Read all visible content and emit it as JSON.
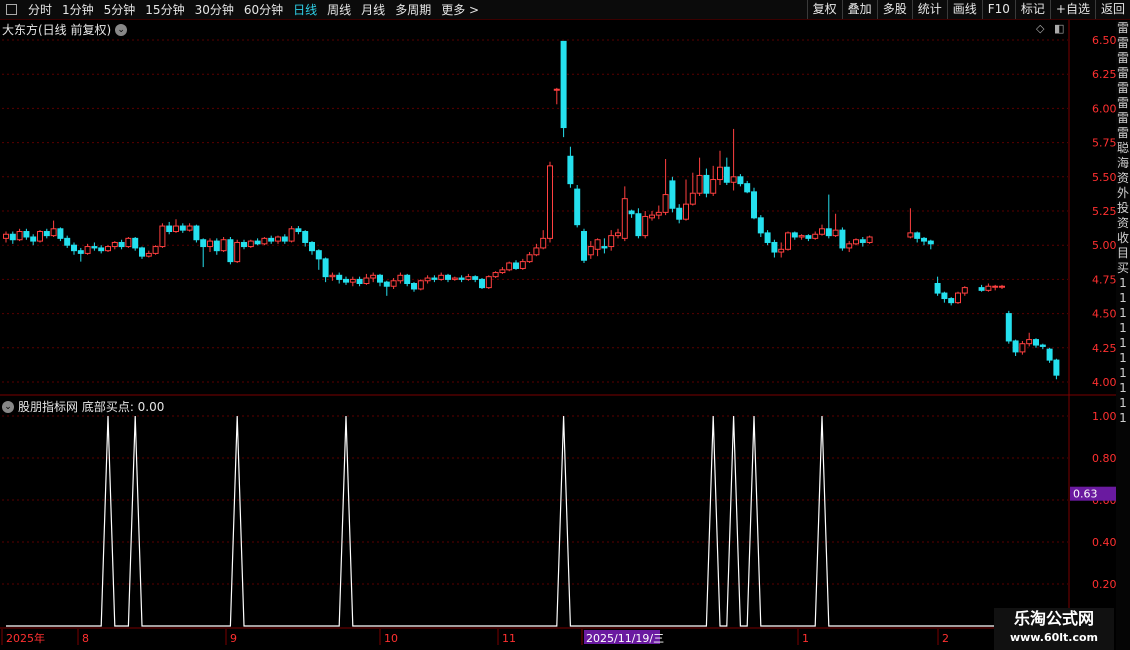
{
  "toolbar": {
    "periods": [
      "分时",
      "1分钟",
      "5分钟",
      "15分钟",
      "30分钟",
      "60分钟",
      "日线",
      "周线",
      "月线",
      "多周期",
      "更多 >"
    ],
    "active_index": 6,
    "right_buttons": [
      "复权",
      "叠加",
      "多股",
      "统计",
      "画线",
      "F10",
      "标记",
      "+自选",
      "返回"
    ]
  },
  "main_title": "大东方(日线 前复权)",
  "indicator_title": "股朋指标网  底部买点: 0.00",
  "sidebar_chars": [
    "雷",
    "雷",
    "雷",
    "雷",
    "雷",
    "雷",
    "雷",
    "雷",
    "聪",
    "海",
    "资",
    "外",
    "投",
    "资",
    "收",
    "目",
    "买",
    "1",
    "1",
    "1",
    "1",
    "1",
    "1",
    "1",
    "1",
    "1",
    "1"
  ],
  "watermark": {
    "line1": "乐淘公式网",
    "line2": "www.60lt.com"
  },
  "colors": {
    "up": "#ff4040",
    "down": "#25e0ee",
    "grid": "#5a0000",
    "axis": "#ff3030",
    "line": "#ffffff",
    "highlight": "#6a1aa0"
  },
  "chart_data": [
    {
      "type": "candlestick",
      "title": "大东方(日线 前复权)",
      "ylim": [
        3.94,
        6.55
      ],
      "y_ticks": [
        "6.50",
        "6.25",
        "6.00",
        "5.75",
        "5.50",
        "5.25",
        "5.00",
        "4.75",
        "4.50",
        "4.25",
        "4.00"
      ],
      "candles": [
        [
          5.05,
          5.08,
          5.1,
          5.02
        ],
        [
          5.08,
          5.04,
          5.1,
          5.01
        ],
        [
          5.04,
          5.1,
          5.12,
          5.03
        ],
        [
          5.1,
          5.06,
          5.12,
          5.04
        ],
        [
          5.06,
          5.03,
          5.08,
          5.0
        ],
        [
          5.03,
          5.1,
          5.11,
          5.02
        ],
        [
          5.1,
          5.07,
          5.12,
          5.05
        ],
        [
          5.07,
          5.12,
          5.18,
          5.06
        ],
        [
          5.12,
          5.05,
          5.13,
          5.03
        ],
        [
          5.05,
          5.0,
          5.07,
          4.98
        ],
        [
          5.0,
          4.96,
          5.02,
          4.93
        ],
        [
          4.96,
          4.94,
          4.98,
          4.88
        ],
        [
          4.94,
          4.99,
          5.01,
          4.93
        ],
        [
          4.99,
          4.98,
          5.02,
          4.96
        ],
        [
          4.98,
          4.96,
          5.0,
          4.94
        ],
        [
          4.96,
          4.99,
          5.0,
          4.95
        ],
        [
          4.99,
          5.02,
          5.03,
          4.97
        ],
        [
          5.02,
          4.99,
          5.04,
          4.97
        ],
        [
          4.99,
          5.05,
          5.06,
          4.98
        ],
        [
          5.05,
          4.98,
          5.06,
          4.96
        ],
        [
          4.98,
          4.92,
          4.99,
          4.9
        ],
        [
          4.92,
          4.94,
          4.96,
          4.91
        ],
        [
          4.94,
          4.99,
          5.0,
          4.93
        ],
        [
          4.99,
          5.14,
          5.16,
          4.98
        ],
        [
          5.14,
          5.1,
          5.17,
          5.08
        ],
        [
          5.1,
          5.14,
          5.19,
          5.09
        ],
        [
          5.14,
          5.11,
          5.16,
          5.09
        ],
        [
          5.11,
          5.14,
          5.16,
          5.1
        ],
        [
          5.14,
          5.04,
          5.15,
          5.02
        ],
        [
          5.04,
          4.99,
          5.05,
          4.84
        ],
        [
          4.99,
          5.03,
          5.05,
          4.95
        ],
        [
          5.03,
          4.96,
          5.05,
          4.93
        ],
        [
          4.96,
          5.04,
          5.06,
          4.95
        ],
        [
          5.04,
          4.88,
          5.06,
          4.86
        ],
        [
          4.88,
          5.02,
          5.04,
          4.87
        ],
        [
          5.02,
          4.99,
          5.04,
          4.97
        ],
        [
          4.99,
          5.03,
          5.04,
          4.98
        ],
        [
          5.03,
          5.01,
          5.05,
          5.0
        ],
        [
          5.01,
          5.05,
          5.06,
          5.0
        ],
        [
          5.05,
          5.03,
          5.07,
          5.01
        ],
        [
          5.03,
          5.06,
          5.07,
          5.01
        ],
        [
          5.06,
          5.03,
          5.08,
          5.01
        ],
        [
          5.03,
          5.12,
          5.14,
          5.02
        ],
        [
          5.12,
          5.1,
          5.14,
          5.08
        ],
        [
          5.1,
          5.02,
          5.11,
          4.99
        ],
        [
          5.02,
          4.96,
          5.03,
          4.93
        ],
        [
          4.96,
          4.9,
          4.97,
          4.82
        ],
        [
          4.9,
          4.77,
          4.91,
          4.73
        ],
        [
          4.77,
          4.78,
          4.8,
          4.74
        ],
        [
          4.78,
          4.75,
          4.8,
          4.72
        ],
        [
          4.75,
          4.73,
          4.77,
          4.71
        ],
        [
          4.73,
          4.75,
          4.77,
          4.7
        ],
        [
          4.75,
          4.72,
          4.77,
          4.7
        ],
        [
          4.72,
          4.76,
          4.79,
          4.71
        ],
        [
          4.76,
          4.78,
          4.8,
          4.73
        ],
        [
          4.78,
          4.73,
          4.79,
          4.7
        ],
        [
          4.73,
          4.7,
          4.74,
          4.63
        ],
        [
          4.7,
          4.74,
          4.76,
          4.68
        ],
        [
          4.74,
          4.78,
          4.8,
          4.72
        ],
        [
          4.78,
          4.72,
          4.79,
          4.7
        ],
        [
          4.72,
          4.68,
          4.73,
          4.66
        ],
        [
          4.68,
          4.74,
          4.75,
          4.67
        ],
        [
          4.74,
          4.76,
          4.78,
          4.72
        ],
        [
          4.76,
          4.75,
          4.78,
          4.73
        ],
        [
          4.75,
          4.78,
          4.8,
          4.74
        ],
        [
          4.78,
          4.75,
          4.79,
          4.73
        ],
        [
          4.75,
          4.76,
          4.77,
          4.74
        ],
        [
          4.76,
          4.75,
          4.78,
          4.73
        ],
        [
          4.75,
          4.77,
          4.79,
          4.74
        ],
        [
          4.77,
          4.75,
          4.78,
          4.73
        ],
        [
          4.75,
          4.69,
          4.76,
          4.68
        ],
        [
          4.69,
          4.77,
          4.78,
          4.68
        ],
        [
          4.77,
          4.8,
          4.81,
          4.76
        ],
        [
          4.8,
          4.82,
          4.84,
          4.79
        ],
        [
          4.82,
          4.87,
          4.88,
          4.81
        ],
        [
          4.87,
          4.83,
          4.89,
          4.82
        ],
        [
          4.83,
          4.88,
          4.9,
          4.82
        ],
        [
          4.88,
          4.93,
          4.95,
          4.87
        ],
        [
          4.93,
          4.98,
          5.01,
          4.92
        ],
        [
          4.98,
          5.05,
          5.11,
          4.97
        ],
        [
          5.05,
          5.58,
          5.61,
          5.02
        ],
        [
          6.14,
          6.14,
          6.15,
          6.03
        ],
        [
          6.49,
          5.86,
          6.49,
          5.79
        ],
        [
          5.65,
          5.45,
          5.72,
          5.42
        ],
        [
          5.41,
          5.15,
          5.44,
          5.13
        ],
        [
          5.1,
          4.89,
          5.12,
          4.87
        ],
        [
          4.93,
          4.99,
          5.03,
          4.9
        ],
        [
          4.97,
          5.04,
          5.05,
          4.92
        ],
        [
          4.99,
          4.98,
          5.05,
          4.94
        ],
        [
          4.99,
          5.07,
          5.11,
          4.96
        ],
        [
          5.07,
          5.09,
          5.12,
          5.05
        ],
        [
          5.05,
          5.34,
          5.43,
          5.03
        ],
        [
          5.25,
          5.23,
          5.26,
          5.2
        ],
        [
          5.23,
          5.07,
          5.27,
          5.05
        ],
        [
          5.07,
          5.21,
          5.25,
          5.05
        ],
        [
          5.2,
          5.22,
          5.25,
          5.18
        ],
        [
          5.22,
          5.24,
          5.29,
          5.19
        ],
        [
          5.24,
          5.37,
          5.63,
          5.22
        ],
        [
          5.47,
          5.27,
          5.5,
          5.24
        ],
        [
          5.27,
          5.19,
          5.3,
          5.16
        ],
        [
          5.19,
          5.3,
          5.48,
          5.18
        ],
        [
          5.3,
          5.38,
          5.53,
          5.29
        ],
        [
          5.38,
          5.51,
          5.64,
          5.36
        ],
        [
          5.51,
          5.38,
          5.56,
          5.35
        ],
        [
          5.38,
          5.48,
          5.58,
          5.36
        ],
        [
          5.48,
          5.57,
          5.69,
          5.44
        ],
        [
          5.57,
          5.46,
          5.64,
          5.44
        ],
        [
          5.46,
          5.5,
          5.85,
          5.4
        ],
        [
          5.5,
          5.45,
          5.52,
          5.43
        ],
        [
          5.45,
          5.39,
          5.47,
          5.38
        ],
        [
          5.39,
          5.2,
          5.42,
          5.19
        ],
        [
          5.2,
          5.09,
          5.22,
          5.06
        ],
        [
          5.09,
          5.02,
          5.11,
          5.0
        ],
        [
          5.02,
          4.95,
          5.04,
          4.91
        ],
        [
          4.95,
          4.97,
          5.02,
          4.91
        ],
        [
          4.97,
          5.09,
          5.1,
          4.96
        ],
        [
          5.09,
          5.06,
          5.1,
          5.04
        ],
        [
          5.06,
          5.07,
          5.08,
          5.04
        ],
        [
          5.07,
          5.05,
          5.08,
          5.03
        ],
        [
          5.05,
          5.08,
          5.1,
          5.04
        ],
        [
          5.08,
          5.12,
          5.15,
          5.07
        ],
        [
          5.12,
          5.07,
          5.37,
          5.05
        ],
        [
          5.07,
          5.11,
          5.23,
          5.06
        ],
        [
          5.11,
          4.98,
          5.13,
          4.96
        ],
        [
          4.98,
          5.01,
          5.03,
          4.95
        ],
        [
          5.01,
          5.04,
          5.05,
          5.0
        ],
        [
          5.04,
          5.02,
          5.06,
          4.99
        ],
        [
          5.02,
          5.06,
          5.07,
          5.01
        ],
        [
          5.06,
          5.09,
          5.27,
          5.05
        ],
        [
          5.09,
          5.05,
          5.1,
          5.02
        ],
        [
          5.05,
          5.03,
          5.06,
          5.0
        ],
        [
          5.03,
          5.01,
          5.04,
          4.97
        ],
        [
          4.72,
          4.65,
          4.77,
          4.63
        ],
        [
          4.65,
          4.61,
          4.66,
          4.58
        ],
        [
          4.61,
          4.58,
          4.62,
          4.56
        ],
        [
          4.58,
          4.65,
          4.66,
          4.57
        ],
        [
          4.65,
          4.69,
          4.7,
          4.63
        ],
        [
          4.69,
          4.67,
          4.71,
          4.66
        ],
        [
          4.67,
          4.7,
          4.72,
          4.66
        ],
        [
          4.7,
          4.7,
          4.71,
          4.67
        ],
        [
          4.7,
          4.7,
          4.71,
          4.68
        ],
        [
          4.5,
          4.3,
          4.52,
          4.28
        ],
        [
          4.3,
          4.22,
          4.31,
          4.19
        ],
        [
          4.22,
          4.28,
          4.3,
          4.2
        ],
        [
          4.28,
          4.31,
          4.36,
          4.26
        ],
        [
          4.31,
          4.27,
          4.32,
          4.25
        ],
        [
          4.27,
          4.26,
          4.28,
          4.24
        ],
        [
          4.24,
          4.16,
          4.25,
          4.14
        ],
        [
          4.16,
          4.05,
          4.17,
          4.02
        ]
      ]
    },
    {
      "type": "line",
      "title": "底部买点",
      "series_label": "股朋指标网",
      "ylim": [
        -0.05,
        1.05
      ],
      "y_ticks": [
        "1.00",
        "0.80",
        "0.60",
        "0.40",
        "0.20"
      ],
      "current_value_marker": "0.63",
      "spike_indices": [
        15,
        19,
        34,
        50,
        82,
        104,
        107,
        110,
        120
      ],
      "values_note": "0 on every other candle, 1 at spike_indices"
    }
  ],
  "x_axis": {
    "labels": [
      "2025年",
      "8",
      "9",
      "10",
      "11",
      "2025/11/19/三",
      "1",
      "2"
    ]
  }
}
